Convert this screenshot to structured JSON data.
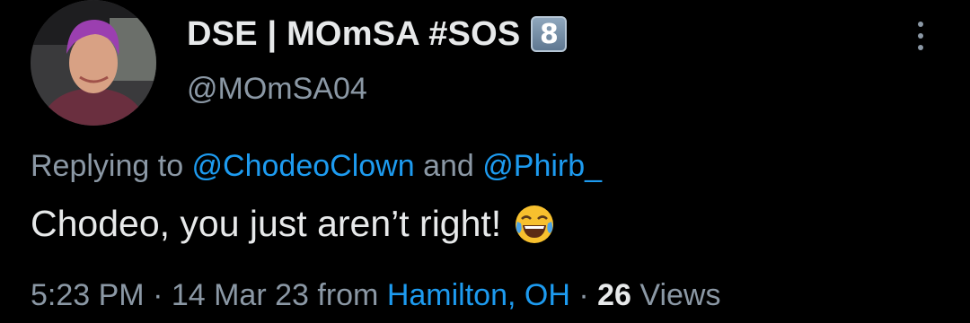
{
  "user": {
    "display_name": "DSE | MOmSA #SOS",
    "badge_emoji": "8",
    "handle": "@MOmSA04"
  },
  "reply": {
    "prefix": "Replying to ",
    "mention_1": "@ChodeoClown",
    "conjunction": " and ",
    "mention_2": "@Phirb_"
  },
  "tweet": {
    "text": "Chodeo, you just aren’t right!",
    "emoji": "face-with-tears-of-joy"
  },
  "meta": {
    "time": "5:23 PM",
    "sep1": " · ",
    "date": "14 Mar 23",
    "from_label": " from ",
    "location": "Hamilton, OH",
    "sep2": " · ",
    "views_count": "26",
    "views_label": " Views"
  },
  "colors": {
    "background": "#000000",
    "text": "#e7e9ea",
    "secondary": "#8b98a5",
    "link": "#1d9bf0"
  },
  "icons": {
    "more": "more-vertical-icon",
    "badge": "keycap-8-icon"
  }
}
